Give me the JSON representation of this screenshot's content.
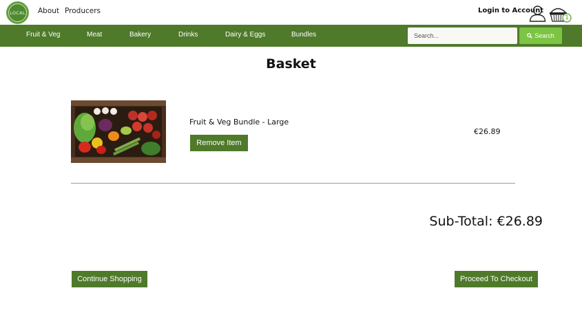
{
  "header": {
    "logo_text": "LOCAL",
    "links": [
      "About",
      "Producers"
    ],
    "login_label": "Login to Account",
    "basket_count": "1",
    "user_icon": "user-icon",
    "basket_icon": "basket-icon"
  },
  "nav": {
    "items": [
      "Fruit & Veg",
      "Meat",
      "Bakery",
      "Drinks",
      "Dairy & Eggs",
      "Bundles"
    ],
    "search": {
      "placeholder": "Search...",
      "button_label": "Search",
      "icon": "search-icon"
    }
  },
  "page": {
    "title": "Basket"
  },
  "basket": {
    "items": [
      {
        "name": "Fruit & Veg Bundle - Large",
        "price": "€26.89",
        "remove_label": "Remove Item",
        "image": "vegetable-crate-image"
      }
    ],
    "subtotal_label": "Sub-Total: €26.89"
  },
  "actions": {
    "continue_label": "Continue Shopping",
    "checkout_label": "Proceed To Checkout"
  },
  "colors": {
    "nav_green": "#4e7a2a",
    "search_button_green": "#7cc443",
    "logo_green": "#4f8a2f"
  }
}
